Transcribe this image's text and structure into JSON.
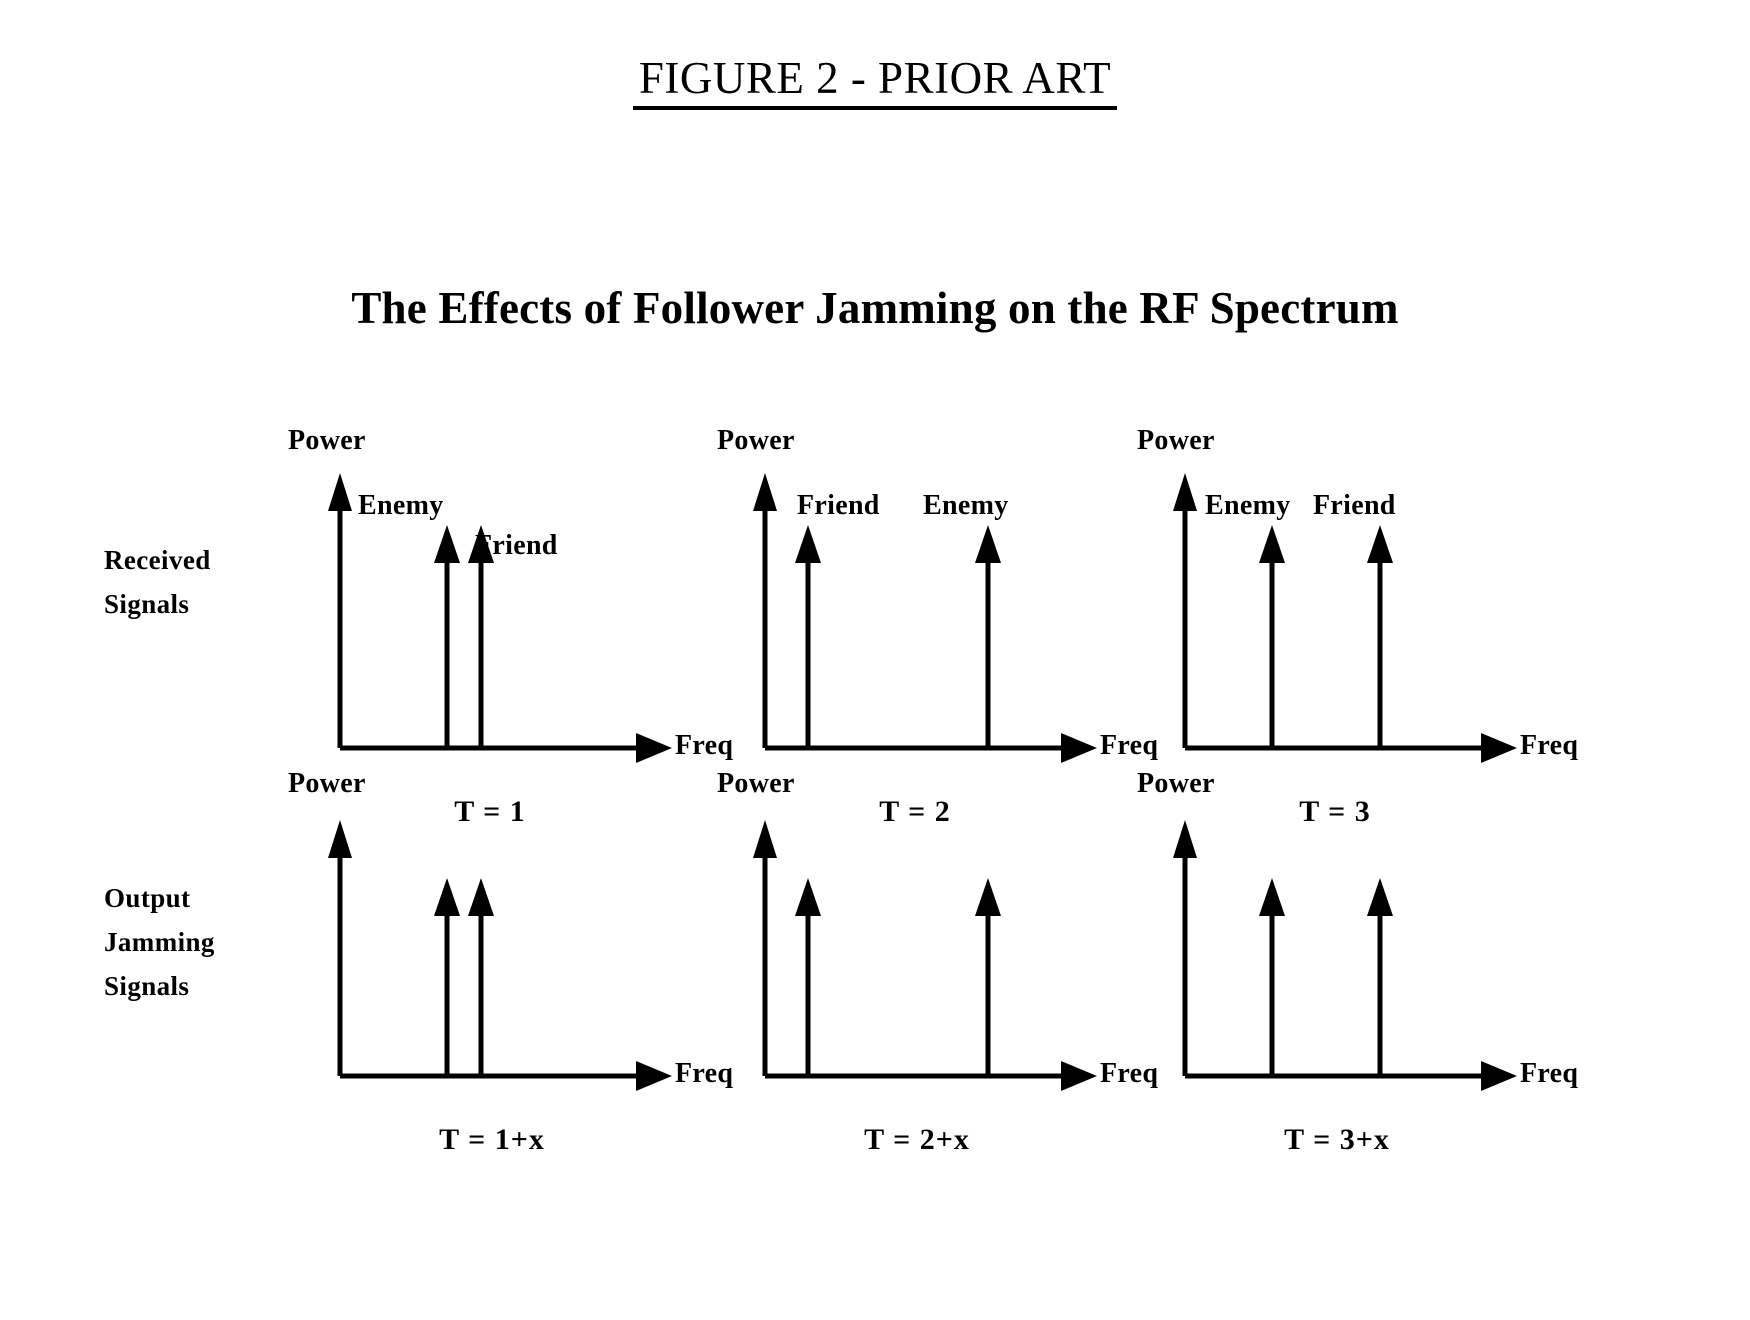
{
  "figure": {
    "title": "FIGURE 2 - PRIOR ART",
    "subtitle": "The Effects of Follower Jamming on the RF Spectrum"
  },
  "row_labels": {
    "received": "Received\nSignals",
    "output": "Output\nJamming\nSignals"
  },
  "axis": {
    "power": "Power",
    "freq": "Freq"
  },
  "signals": {
    "enemy": "Enemy",
    "friend": "Friend"
  },
  "panels": {
    "r1c1": {
      "time": "T = 1",
      "left_label": "Enemy",
      "right_label": "Friend"
    },
    "r1c2": {
      "time": "T = 2",
      "left_label": "Friend",
      "right_label": "Enemy"
    },
    "r1c3": {
      "time": "T = 3",
      "left_label": "Enemy",
      "right_label": "Friend"
    },
    "r2c1": {
      "time": "T = 1+x"
    },
    "r2c2": {
      "time": "T = 2+x"
    },
    "r2c3": {
      "time": "T = 3+x"
    }
  },
  "colors": {
    "ink": "#000000",
    "paper": "#ffffff"
  },
  "chart_data": [
    {
      "type": "bar",
      "id": "received-T1",
      "title": "T = 1",
      "xlabel": "Freq",
      "ylabel": "Power",
      "grid": false,
      "legend": "none",
      "categories": [
        "Enemy",
        "Friend"
      ],
      "x": [
        0.42,
        0.53
      ],
      "values": [
        0.78,
        0.78
      ],
      "ylim": [
        0,
        1
      ],
      "annotations": [
        "Enemy",
        "Friend"
      ]
    },
    {
      "type": "bar",
      "id": "received-T2",
      "title": "T = 2",
      "xlabel": "Freq",
      "ylabel": "Power",
      "grid": false,
      "legend": "none",
      "categories": [
        "Friend",
        "Enemy"
      ],
      "x": [
        0.17,
        0.87
      ],
      "values": [
        0.78,
        0.78
      ],
      "ylim": [
        0,
        1
      ],
      "annotations": [
        "Friend",
        "Enemy"
      ]
    },
    {
      "type": "bar",
      "id": "received-T3",
      "title": "T = 3",
      "xlabel": "Freq",
      "ylabel": "Power",
      "grid": false,
      "legend": "none",
      "categories": [
        "Enemy",
        "Friend"
      ],
      "x": [
        0.3,
        0.66
      ],
      "values": [
        0.78,
        0.78
      ],
      "ylim": [
        0,
        1
      ],
      "annotations": [
        "Enemy",
        "Friend"
      ]
    },
    {
      "type": "bar",
      "id": "jamming-T1x",
      "title": "T = 1+x",
      "xlabel": "Freq",
      "ylabel": "Power",
      "grid": false,
      "legend": "none",
      "categories": [
        "",
        ""
      ],
      "x": [
        0.42,
        0.53
      ],
      "values": [
        0.72,
        0.72
      ],
      "ylim": [
        0,
        1
      ],
      "annotations": []
    },
    {
      "type": "bar",
      "id": "jamming-T2x",
      "title": "T = 2+x",
      "xlabel": "Freq",
      "ylabel": "Power",
      "grid": false,
      "legend": "none",
      "categories": [
        "",
        ""
      ],
      "x": [
        0.17,
        0.87
      ],
      "values": [
        0.72,
        0.72
      ],
      "ylim": [
        0,
        1
      ],
      "annotations": []
    },
    {
      "type": "bar",
      "id": "jamming-T3x",
      "title": "T = 3+x",
      "xlabel": "Freq",
      "ylabel": "Power",
      "grid": false,
      "legend": "none",
      "categories": [
        "",
        ""
      ],
      "x": [
        0.3,
        0.66
      ],
      "values": [
        0.72,
        0.72
      ],
      "ylim": [
        0,
        1
      ],
      "annotations": []
    }
  ]
}
